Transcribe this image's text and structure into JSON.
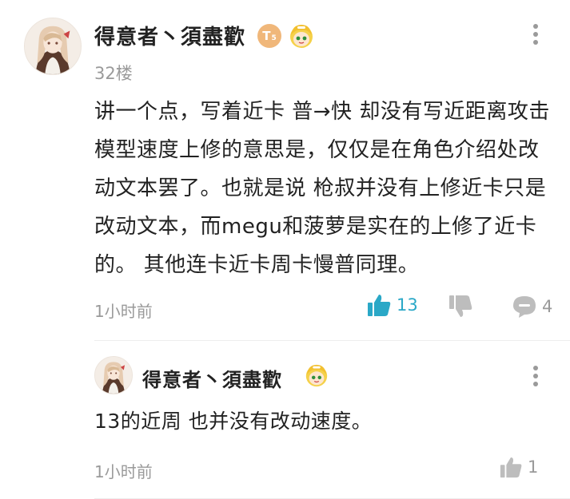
{
  "comment": {
    "username": "得意者丶須盡歡",
    "level_badge": "T",
    "level_badge_sub": "5",
    "floor": "32楼",
    "body": "讲一个点，写着近卡 普→快 却没有写近距离攻击模型速度上修的意思是，仅仅是在角色介绍处改动文本罢了。也就是说 枪叔并没有上修近卡只是改动文本，而megu和菠萝是实在的上修了近卡的。 其他连卡近卡周卡慢普同理。",
    "time": "1小时前",
    "like_count": "13",
    "reply_count": "4",
    "like_icon": "thumbs-up-icon",
    "dislike_icon": "thumbs-down-icon",
    "reply_icon": "chat-bubble-icon",
    "more_icon": "more-vertical-icon",
    "accent_color": "#2aa8c7"
  },
  "reply": {
    "username": "得意者丶須盡歡",
    "body": "13的近周 也并没有改动速度。",
    "time": "1小时前",
    "like_count": "1",
    "like_icon": "thumbs-up-icon",
    "more_icon": "more-vertical-icon"
  }
}
